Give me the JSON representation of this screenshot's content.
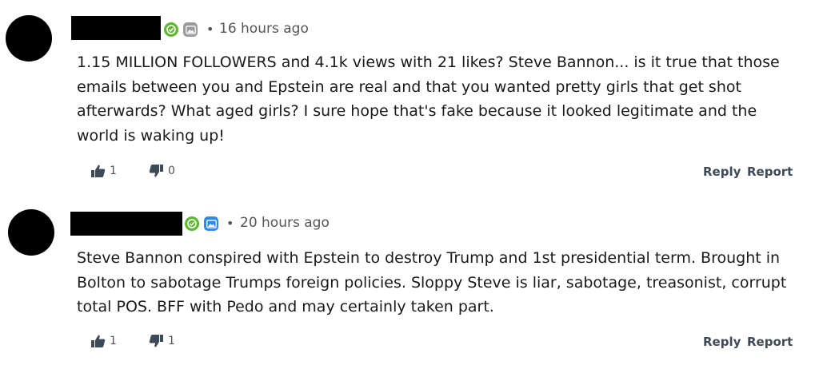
{
  "colors": {
    "verified_badge": "#5fb832",
    "grey_badge": "#9a9a9a",
    "blue_badge": "#2d8ae8",
    "action_text": "#3d4a57"
  },
  "comments": [
    {
      "separator": "•",
      "time": "16 hours ago",
      "badges": [
        "verified-check-icon",
        "grey-mountain-icon"
      ],
      "body": "1.15 MILLION FOLLOWERS and 4.1k views with 21 likes? Steve Bannon... is it true that those emails between you and Epstein are real and that you wanted pretty girls that get shot afterwards? What aged girls? I sure hope that's fake because it looked legitimate and the world is waking up!",
      "likes": "1",
      "dislikes": "0",
      "reply_label": "Reply",
      "report_label": "Report"
    },
    {
      "separator": "•",
      "time": "20 hours ago",
      "badges": [
        "verified-check-icon",
        "blue-mountain-icon"
      ],
      "body": "Steve Bannon conspired with Epstein to destroy Trump and 1st presidential term. Brought in Bolton to sabotage Trumps foreign policies. Sloppy Steve is liar, sabotage, treasonist, corrupt total POS. BFF with Pedo and may certainly taken part.",
      "likes": "1",
      "dislikes": "1",
      "reply_label": "Reply",
      "report_label": "Report"
    }
  ]
}
